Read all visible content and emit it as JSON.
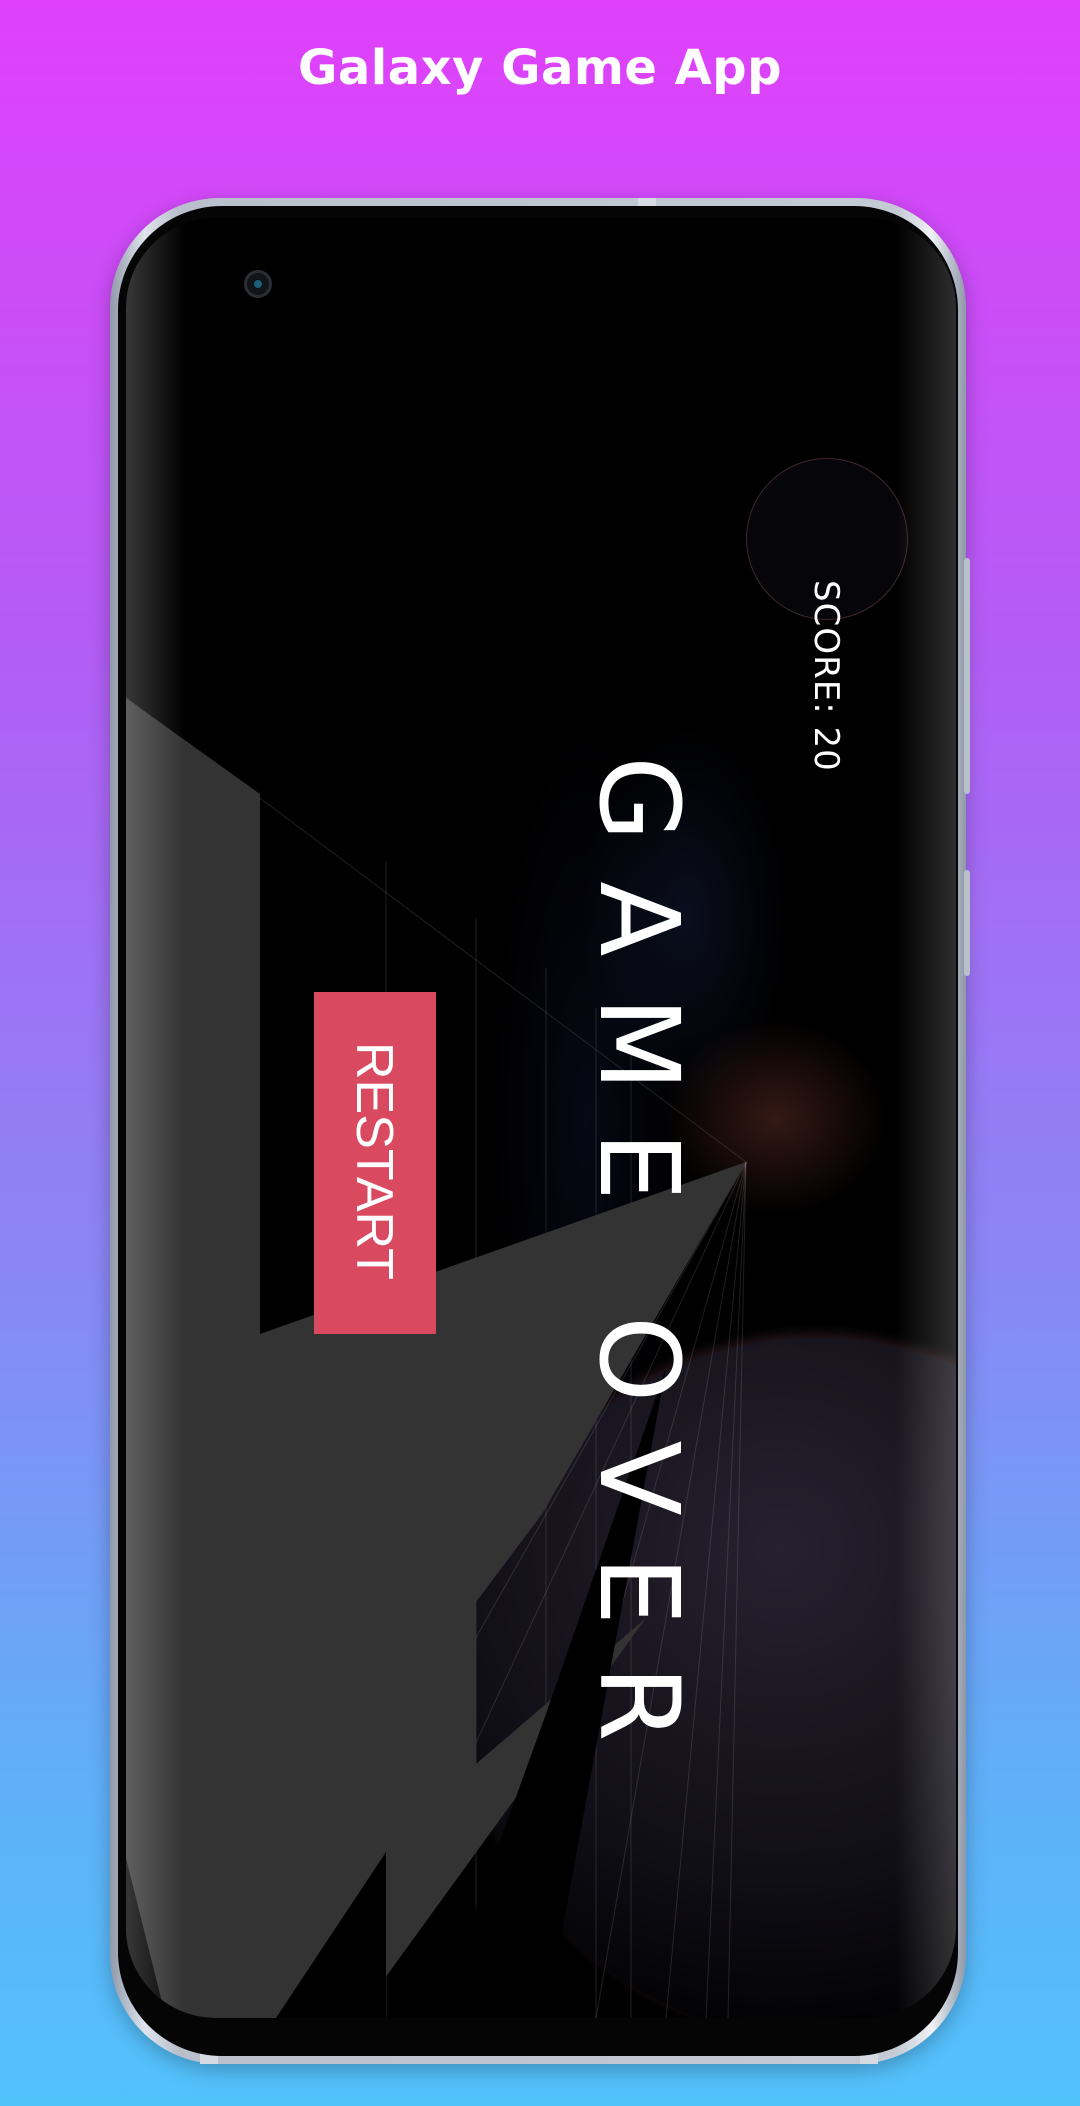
{
  "header": {
    "title": "Galaxy Game App"
  },
  "game": {
    "score_text": "SCORE: 20",
    "game_over_text": "GAME OVER",
    "restart_label": "RESTART"
  },
  "colors": {
    "background_top": "#e040fb",
    "background_bottom": "#52c2fb",
    "restart_button": "#d94a60",
    "terrain": "#333333",
    "text": "#ffffff"
  }
}
